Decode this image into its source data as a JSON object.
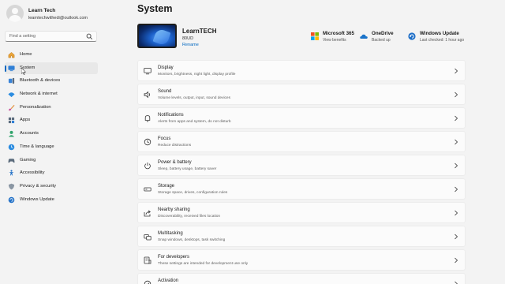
{
  "profile": {
    "name": "Learn Tech",
    "email": "learntechwithedi@outlook.com"
  },
  "search": {
    "placeholder": "Find a setting"
  },
  "nav": [
    {
      "label": "Home",
      "icon": "home-icon"
    },
    {
      "label": "System",
      "icon": "system-icon",
      "selected": true
    },
    {
      "label": "Bluetooth & devices",
      "icon": "bluetooth-icon"
    },
    {
      "label": "Network & internet",
      "icon": "network-icon"
    },
    {
      "label": "Personalization",
      "icon": "brush-icon"
    },
    {
      "label": "Apps",
      "icon": "apps-icon"
    },
    {
      "label": "Accounts",
      "icon": "accounts-icon"
    },
    {
      "label": "Time & language",
      "icon": "globe-clock-icon"
    },
    {
      "label": "Gaming",
      "icon": "gaming-icon"
    },
    {
      "label": "Accessibility",
      "icon": "accessibility-icon"
    },
    {
      "label": "Privacy & security",
      "icon": "shield-icon"
    },
    {
      "label": "Windows Update",
      "icon": "update-icon"
    }
  ],
  "page_title": "System",
  "device": {
    "name": "LearnTECH",
    "model": "80UD",
    "rename_label": "Rename"
  },
  "status": [
    {
      "title": "Microsoft 365",
      "sub": "View benefits",
      "icon": "microsoft-logo-icon"
    },
    {
      "title": "OneDrive",
      "sub": "Backed up",
      "icon": "onedrive-icon"
    },
    {
      "title": "Windows Update",
      "sub": "Last checked: 1 hour ago",
      "icon": "windows-update-icon"
    }
  ],
  "cards": [
    {
      "title": "Display",
      "sub": "Monitors, brightness, night light, display profile",
      "icon": "display-icon"
    },
    {
      "title": "Sound",
      "sub": "Volume levels, output, input, sound devices",
      "icon": "sound-icon"
    },
    {
      "title": "Notifications",
      "sub": "Alerts from apps and system, do not disturb",
      "icon": "bell-icon"
    },
    {
      "title": "Focus",
      "sub": "Reduce distractions",
      "icon": "focus-icon"
    },
    {
      "title": "Power & battery",
      "sub": "Sleep, battery usage, battery saver",
      "icon": "power-icon"
    },
    {
      "title": "Storage",
      "sub": "Storage space, drives, configuration rules",
      "icon": "storage-icon"
    },
    {
      "title": "Nearby sharing",
      "sub": "Discoverability, received files location",
      "icon": "share-icon"
    },
    {
      "title": "Multitasking",
      "sub": "Snap windows, desktops, task switching",
      "icon": "multitasking-icon"
    },
    {
      "title": "For developers",
      "sub": "These settings are intended for development use only",
      "icon": "developer-icon"
    },
    {
      "title": "Activation",
      "sub": "",
      "icon": "activation-icon"
    }
  ],
  "colors": {
    "accent": "#0067c0",
    "background": "#f3f3f3",
    "card": "#fbfbfb"
  }
}
